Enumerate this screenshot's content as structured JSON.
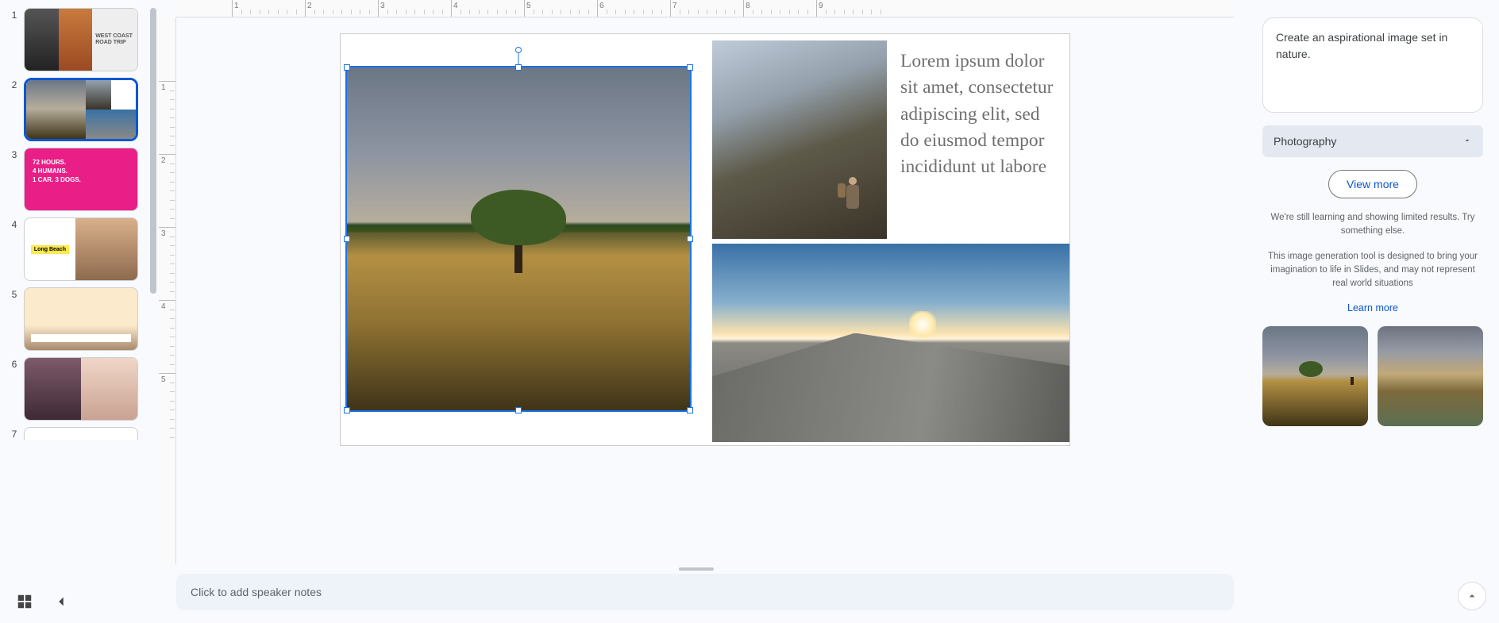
{
  "slides": [
    {
      "num": "1",
      "title_lines": [
        "WEST COAST",
        "ROAD TRIP"
      ]
    },
    {
      "num": "2"
    },
    {
      "num": "3",
      "lines": [
        "72 HOURS.",
        "4 HUMANS.",
        "1 CAR. 3 DOGS."
      ]
    },
    {
      "num": "4",
      "badge": "Long Beach"
    },
    {
      "num": "5"
    },
    {
      "num": "6"
    },
    {
      "num": "7"
    }
  ],
  "selected_slide_index": 1,
  "canvas": {
    "body_text": "Lorem ipsum dolor sit amet, consectetur adipiscing elit, sed do eiusmod tempor incididunt ut labore"
  },
  "ruler": {
    "h_majors": [
      "1",
      "2",
      "3",
      "4",
      "5",
      "6",
      "7",
      "8",
      "9"
    ],
    "v_majors": [
      "1",
      "2",
      "3",
      "4",
      "5"
    ]
  },
  "speaker_notes_placeholder": "Click to add speaker notes",
  "sidebar": {
    "prompt_text": "Create an aspirational image set in nature.",
    "style_selected": "Photography",
    "view_more_label": "View more",
    "hint": "We're still learning and showing limited results. Try something else.",
    "disclaimer": "This image generation tool is designed to bring your imagination to life in Slides, and may not represent real world situations",
    "learn_more_label": "Learn more"
  }
}
